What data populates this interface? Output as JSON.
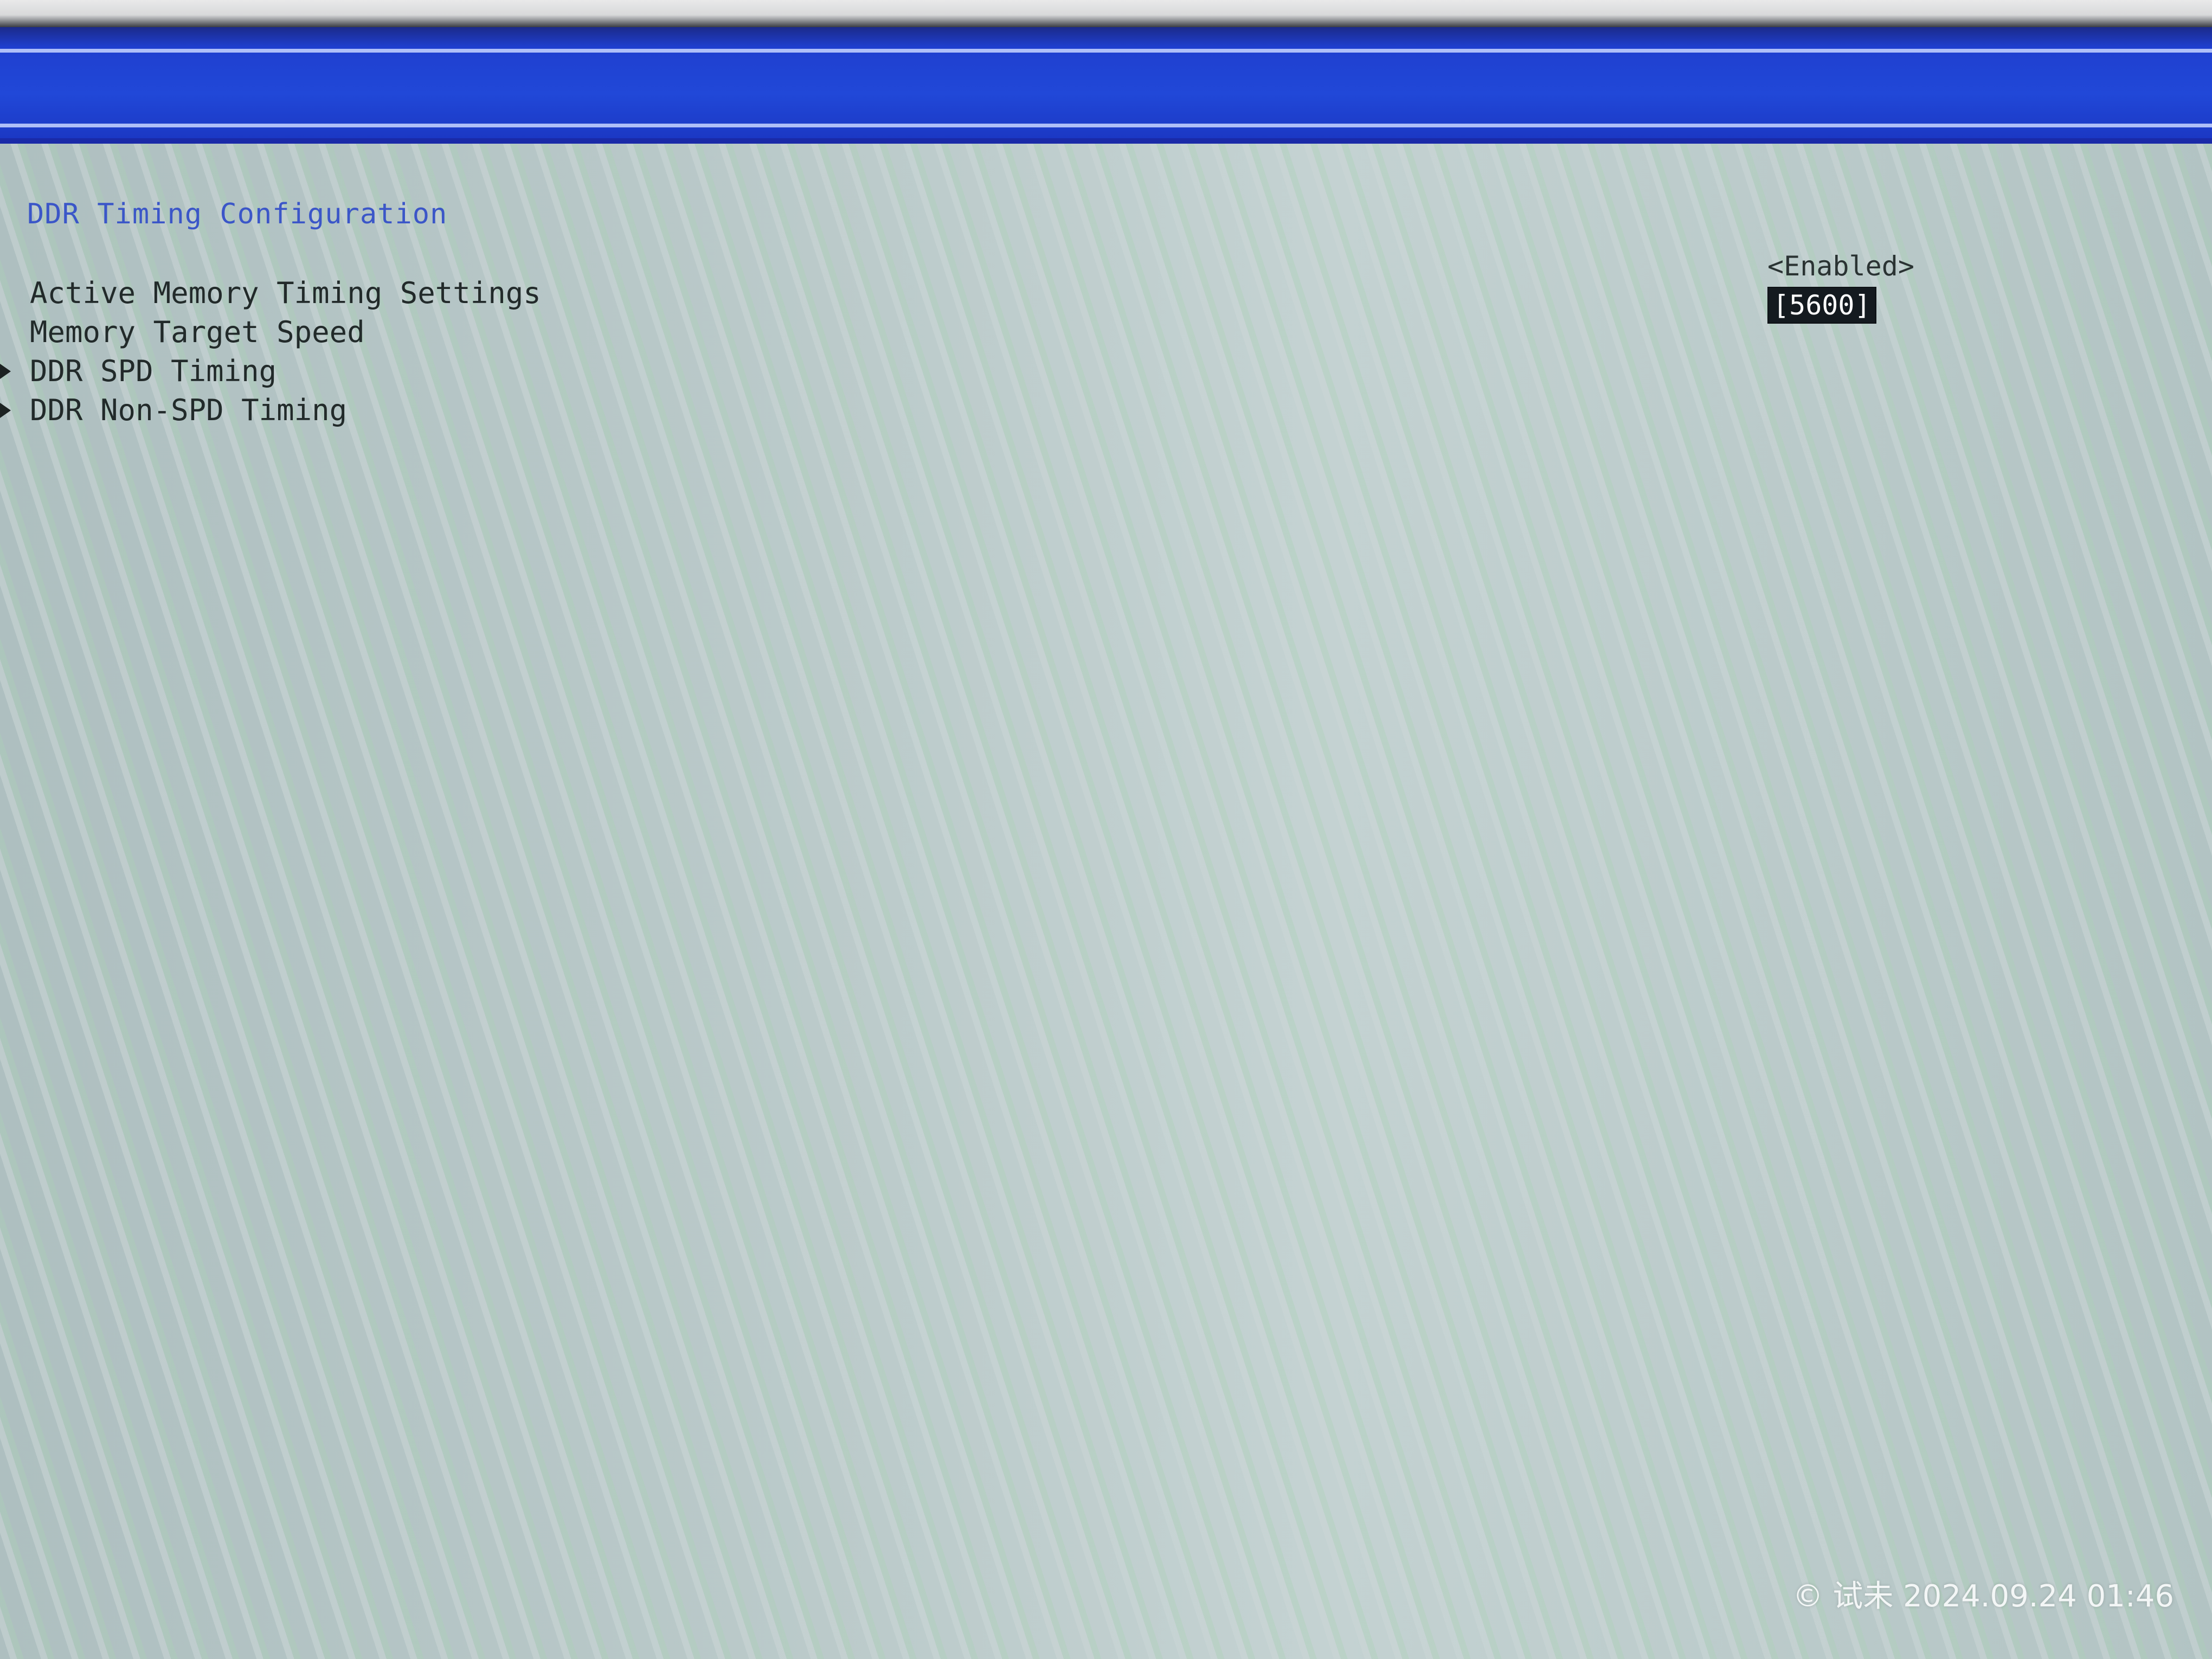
{
  "page": {
    "heading": "DDR Timing Configuration"
  },
  "menu": {
    "items": [
      {
        "label": "Active Memory Timing Settings",
        "submenu": false,
        "value": "<Enabled>",
        "selected": false
      },
      {
        "label": "Memory Target Speed",
        "submenu": false,
        "value": "[5600]",
        "selected": true
      },
      {
        "label": "DDR SPD Timing",
        "submenu": true
      },
      {
        "label": "DDR Non-SPD Timing",
        "submenu": true
      }
    ]
  },
  "watermark": {
    "text": "© 试未 2024.09.24 01:46"
  },
  "colors": {
    "title_bar": "#2148d8",
    "background": "#b9c9c9",
    "heading_text": "#3b56c8",
    "selected_bg": "#141a1f",
    "selected_text": "#ffffff"
  }
}
